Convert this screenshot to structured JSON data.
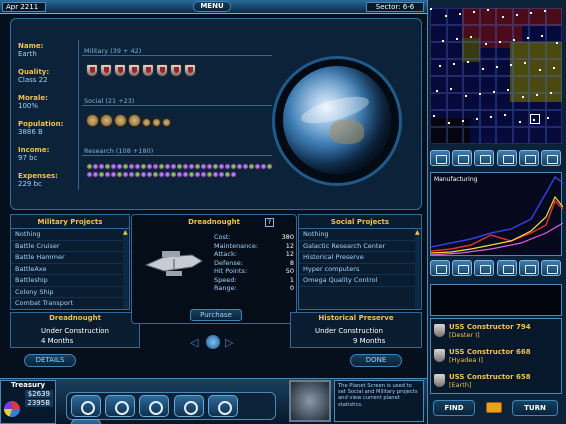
{
  "topbar": {
    "date": "Apr 2211",
    "menu": "MENU",
    "sector": "Sector: 6-6"
  },
  "planet": {
    "fields": [
      {
        "label": "Name:",
        "value": "Earth"
      },
      {
        "label": "Quality:",
        "value": "Class 22"
      },
      {
        "label": "Morale:",
        "value": "100%"
      },
      {
        "label": "Population:",
        "value": "3886 B"
      },
      {
        "label": "Income:",
        "value": "97 bc"
      },
      {
        "label": "Expenses:",
        "value": "229 bc"
      }
    ],
    "military_label": "Military  (39 + 42)",
    "social_label": "Social  (21 +23)",
    "research_label": "Research  (108 +180)",
    "military_icons": 8,
    "social_icons": 4,
    "social_small_icons": 3,
    "research_icons": 56
  },
  "military_projects": {
    "title": "Military Projects",
    "items": [
      "Nothing",
      "Battle Cruiser",
      "Battle Hammer",
      "BattleAxe",
      "Battleship",
      "Colony Ship",
      "Combat Transport"
    ],
    "selected": "Dreadnought",
    "status": "Under Construction",
    "time": "4 Months"
  },
  "ship": {
    "title": "Dreadnought",
    "help": "?",
    "stats": [
      {
        "label": "Cost:",
        "value": "380"
      },
      {
        "label": "Maintenance:",
        "value": "12"
      },
      {
        "label": "Attack:",
        "value": "12"
      },
      {
        "label": "Defense:",
        "value": "8"
      },
      {
        "label": "Hit Points:",
        "value": "50"
      },
      {
        "label": "Speed:",
        "value": "1"
      },
      {
        "label": "Range:",
        "value": "0"
      }
    ],
    "purchase": "Purchase"
  },
  "social_projects": {
    "title": "Social Projects",
    "items": [
      "Nothing",
      "Galactic Research Center",
      "Historical Preserve",
      "Hyper computers",
      "Omega Quality Control"
    ],
    "selected": "Historical Preserve",
    "status": "Under  Construction",
    "time": "9 Months"
  },
  "buttons": {
    "details": "DETAILS",
    "done": "DONE",
    "find": "FIND",
    "turn": "TURN"
  },
  "treasury": {
    "title": "Treasury",
    "money": "$2639",
    "pop": "2395B"
  },
  "tooltip": "The Planet Screen is used to set Social and Military projects and view current planet statistics.",
  "chart": {
    "title": "Manufacturing"
  },
  "fleet": {
    "items": [
      {
        "name": "USS Constructor 794",
        "loc": "[Dester I]"
      },
      {
        "name": "USS Constructor 668",
        "loc": "[Hyadea I]"
      },
      {
        "name": "USS Constructor 658",
        "loc": "[Earth]"
      }
    ]
  },
  "colors": {
    "accent": "#f2c24a",
    "text": "#9fd2ff",
    "border": "#2d6a99"
  }
}
